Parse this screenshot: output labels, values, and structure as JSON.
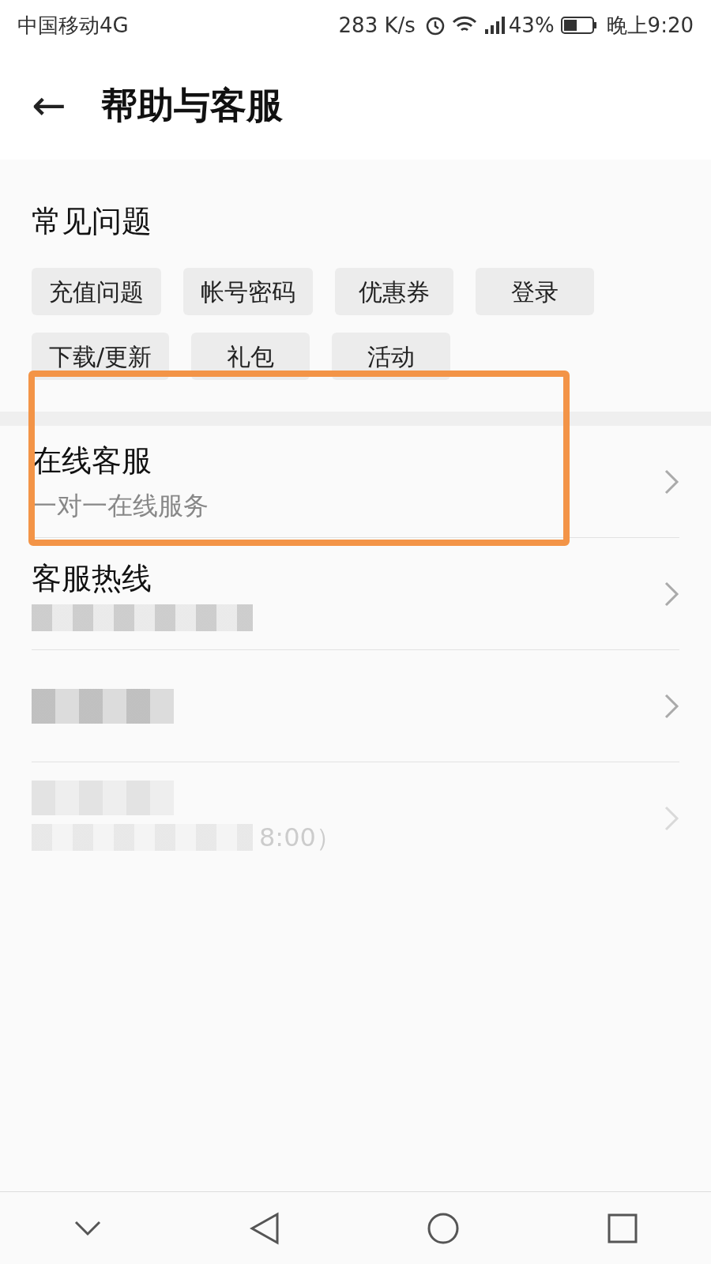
{
  "status_bar": {
    "carrier": "中国移动4G",
    "speed": "283 K/s",
    "battery": "43%",
    "time": "晚上9:20"
  },
  "header": {
    "back": "←",
    "title": "帮助与客服"
  },
  "faq": {
    "title": "常见问题",
    "tags": [
      {
        "label": "充值问题"
      },
      {
        "label": "帐号密码"
      },
      {
        "label": "优惠券"
      },
      {
        "label": "登录"
      },
      {
        "label": "下载/更新"
      },
      {
        "label": "礼包"
      },
      {
        "label": "活动"
      }
    ]
  },
  "services": [
    {
      "title": "在线客服",
      "subtitle": "一对一在线服务",
      "highlighted": true,
      "disabled": false
    },
    {
      "title": "客服热线",
      "highlighted": false,
      "disabled": false,
      "kind": "subblur"
    },
    {
      "highlighted": false,
      "disabled": false,
      "kind": "titleblur"
    },
    {
      "subtitle": "8:00）",
      "highlighted": false,
      "disabled": true,
      "kind": "allblur"
    }
  ]
}
